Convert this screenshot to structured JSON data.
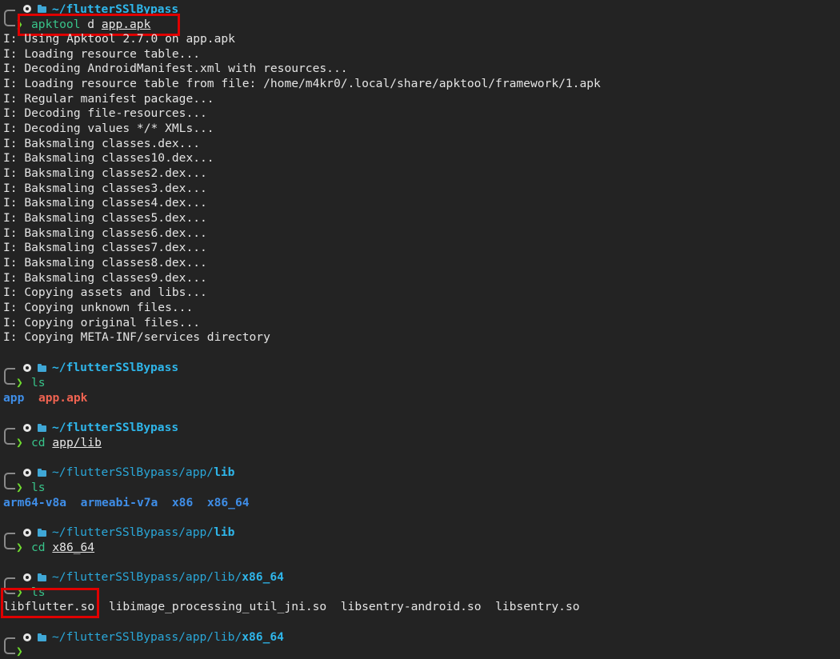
{
  "prompts": [
    {
      "path_dim": "~/",
      "path_bold": "flutterSSlBypass",
      "cmd": "apktool",
      "pre": " d ",
      "arg": "app.apk"
    },
    {
      "path_dim": "~/",
      "path_bold": "flutterSSlBypass",
      "cmd": "ls",
      "pre": "",
      "arg": ""
    },
    {
      "path_dim": "~/",
      "path_bold": "flutterSSlBypass",
      "cmd": "cd",
      "pre": " ",
      "arg": "app/lib"
    },
    {
      "path_dim": "~/flutterSSlBypass/app/",
      "path_bold": "lib",
      "cmd": "ls",
      "pre": "",
      "arg": ""
    },
    {
      "path_dim": "~/flutterSSlBypass/app/",
      "path_bold": "lib",
      "cmd": "cd",
      "pre": " ",
      "arg": "x86_64"
    },
    {
      "path_dim": "~/flutterSSlBypass/app/lib/",
      "path_bold": "x86_64",
      "cmd": "ls",
      "pre": "",
      "arg": ""
    },
    {
      "path_dim": "~/flutterSSlBypass/app/lib/",
      "path_bold": "x86_64",
      "cmd": "",
      "pre": "",
      "arg": ""
    }
  ],
  "apktool_output": [
    "I: Using Apktool 2.7.0 on app.apk",
    "I: Loading resource table...",
    "I: Decoding AndroidManifest.xml with resources...",
    "I: Loading resource table from file: /home/m4kr0/.local/share/apktool/framework/1.apk",
    "I: Regular manifest package...",
    "I: Decoding file-resources...",
    "I: Decoding values */* XMLs...",
    "I: Baksmaling classes.dex...",
    "I: Baksmaling classes10.dex...",
    "I: Baksmaling classes2.dex...",
    "I: Baksmaling classes3.dex...",
    "I: Baksmaling classes4.dex...",
    "I: Baksmaling classes5.dex...",
    "I: Baksmaling classes6.dex...",
    "I: Baksmaling classes7.dex...",
    "I: Baksmaling classes8.dex...",
    "I: Baksmaling classes9.dex...",
    "I: Copying assets and libs...",
    "I: Copying unknown files...",
    "I: Copying original files...",
    "I: Copying META-INF/services directory"
  ],
  "ls1": {
    "dir": "app",
    "apk": "app.apk"
  },
  "ls2": [
    "arm64-v8a",
    "armeabi-v7a",
    "x86",
    "x86_64"
  ],
  "ls3": [
    "libflutter.so",
    "libimage_processing_util_jni.so",
    "libsentry-android.so",
    "libsentry.so"
  ],
  "arrow_glyph": "❯",
  "colors": {
    "background": "#232323",
    "path": "#2aa7d8",
    "command": "#38c48a",
    "arrow": "#6fdc2f",
    "directory": "#3f8ee8",
    "archive": "#ef6351",
    "highlight": "#e00000"
  },
  "icons": [
    "linux-icon",
    "folder-icon"
  ]
}
